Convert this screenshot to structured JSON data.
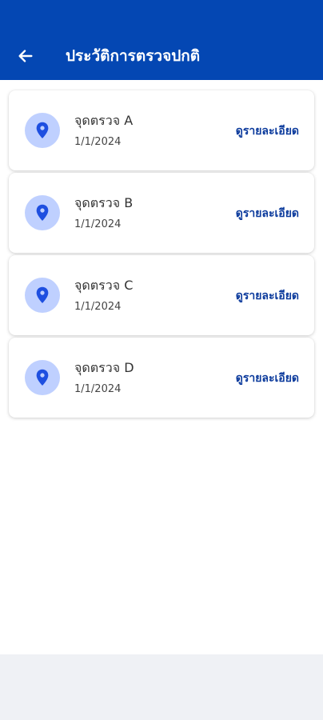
{
  "header": {
    "title": "ประวัติการตรวจปกติ",
    "back_icon": "arrow-left-icon",
    "background_color": "#0447B3"
  },
  "items": [
    {
      "name": "จุดตรวจ A",
      "date": "1/1/2024",
      "detail_label": "ดูรายละเอียด",
      "icon": "map-pin-icon"
    },
    {
      "name": "จุดตรวจ B",
      "date": "1/1/2024",
      "detail_label": "ดูรายละเอียด",
      "icon": "map-pin-icon"
    },
    {
      "name": "จุดตรวจ C",
      "date": "1/1/2024",
      "detail_label": "ดูรายละเอียด",
      "icon": "map-pin-icon"
    },
    {
      "name": "จุดตรวจ D",
      "date": "1/1/2024",
      "detail_label": "ดูรายละเอียด",
      "icon": "map-pin-icon"
    }
  ],
  "colors": {
    "accent": "#0447B3",
    "link": "#0B3A9C",
    "icon_bg": "#BFD0FF",
    "icon_fg": "#1E4FE0"
  }
}
